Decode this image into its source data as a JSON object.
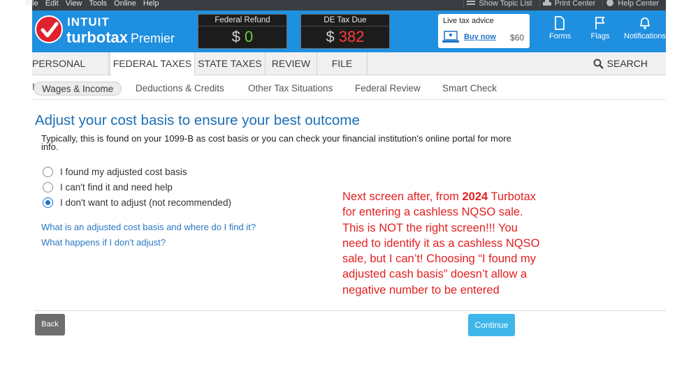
{
  "menu": [
    "File",
    "Edit",
    "View",
    "Tools",
    "Online",
    "Help"
  ],
  "toolbar": {
    "show_topic_list": "Show Topic List",
    "print_center": "Print Center",
    "help_center": "Help Center"
  },
  "brand": {
    "intuit": "INTUIT",
    "turbotax": "turbotax",
    "edition": "Premier"
  },
  "refund": {
    "federal_label": "Federal Refund",
    "federal_currency": "$",
    "federal_value": "0",
    "state_label": "DE Tax Due",
    "state_currency": "$",
    "state_value": "382"
  },
  "advice": {
    "title": "Live tax advice",
    "buy_label": "Buy now",
    "price": "$60"
  },
  "header_buttons": {
    "forms": "Forms",
    "flags": "Flags",
    "notifications": "Notifications"
  },
  "main_tabs": [
    "PERSONAL INFO",
    "FEDERAL TAXES",
    "STATE TAXES",
    "REVIEW",
    "FILE"
  ],
  "search_label": "SEARCH",
  "sub_tabs": [
    "Wages & Income",
    "Deductions & Credits",
    "Other Tax Situations",
    "Federal Review",
    "Smart Check"
  ],
  "page": {
    "title": "Adjust your cost basis to ensure your best outcome",
    "description": "Typically, this is found on your 1099-B as cost basis or you can check your financial institution's online portal for more info.",
    "options": [
      "I found my adjusted cost basis",
      "I can't find it and need help",
      "I don't want to adjust (not recommended)"
    ],
    "selected_option": 2,
    "links": [
      "What is an adjusted cost basis and where do I find it?",
      "What happens if I don't adjust?"
    ]
  },
  "annotation": {
    "prefix": "Next screen after, from ",
    "bold": "2024",
    "rest": " Turbotax for entering a cashless NQSO sale.  This is NOT the right screen!!!  You need to identify it as a cashless NQSO sale, but I can’t! Choosing “I found my adjusted cash basis” doesn’t allow a negative number to be entered"
  },
  "footer": {
    "back_label": "Back",
    "continue_label": "Continue"
  },
  "colors": {
    "header_blue": "#1f8fe0",
    "refund_green": "#6bcf3c",
    "due_red": "#ff3b3b",
    "continue_blue": "#3eb6ea",
    "annotation_red": "#e32020",
    "title_blue": "#1c6fb5"
  }
}
